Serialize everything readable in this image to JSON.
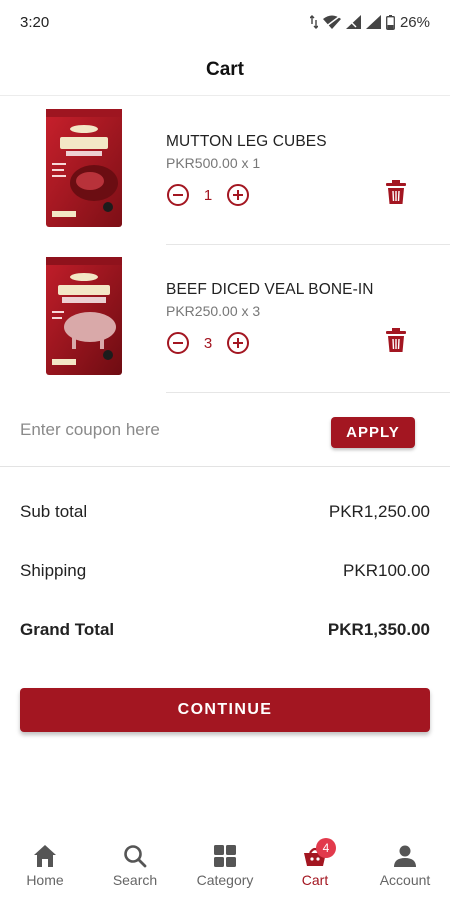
{
  "status_bar": {
    "time": "3:20",
    "battery": "26%",
    "icons": [
      "data-arrows-icon",
      "wifi-icon",
      "signal-icon",
      "signal-icon",
      "battery-icon"
    ]
  },
  "header": {
    "title": "Cart"
  },
  "cart": {
    "items": [
      {
        "name": "MUTTON LEG CUBES",
        "price_line": "PKR500.00 x 1",
        "quantity": "1",
        "image_icon": "mutton-package-image"
      },
      {
        "name": "BEEF DICED VEAL BONE-IN",
        "price_line": "PKR250.00 x 3",
        "quantity": "3",
        "image_icon": "beef-package-image"
      }
    ]
  },
  "coupon": {
    "placeholder": "Enter coupon here",
    "value": "",
    "apply_label": "APPLY"
  },
  "summary": {
    "subtotal_label": "Sub total",
    "subtotal_value": "PKR1,250.00",
    "shipping_label": "Shipping",
    "shipping_value": "PKR100.00",
    "grand_total_label": "Grand Total",
    "grand_total_value": "PKR1,350.00"
  },
  "continue_label": "CONTINUE",
  "bottom_nav": {
    "items": [
      {
        "label": "Home",
        "icon": "home-icon"
      },
      {
        "label": "Search",
        "icon": "search-icon"
      },
      {
        "label": "Category",
        "icon": "grid-icon"
      },
      {
        "label": "Cart",
        "icon": "cart-icon",
        "badge": "4",
        "active": true
      },
      {
        "label": "Account",
        "icon": "person-icon"
      }
    ]
  },
  "colors": {
    "accent": "#a31621",
    "badge": "#e23a4c",
    "text": "#222222",
    "muted": "#777777"
  }
}
